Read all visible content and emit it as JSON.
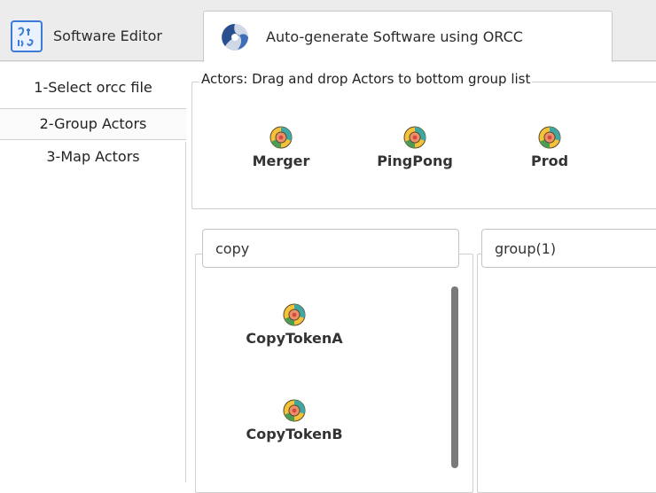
{
  "tabs": [
    {
      "label": "Software Editor",
      "icon": "software-editor-icon",
      "active": false
    },
    {
      "label": "Auto-generate Software using ORCC",
      "icon": "orcc-icon",
      "active": true
    }
  ],
  "steps": [
    {
      "label": "1-Select orcc file",
      "selected": false
    },
    {
      "label": "2-Group Actors",
      "selected": true
    },
    {
      "label": "3-Map Actors",
      "selected": false
    }
  ],
  "actors_panel": {
    "title": "Actors: Drag and drop Actors to bottom group list",
    "actors": [
      {
        "label": "Merger",
        "icon": "actor-icon"
      },
      {
        "label": "PingPong",
        "icon": "actor-icon"
      },
      {
        "label": "Prod",
        "icon": "actor-icon"
      }
    ]
  },
  "groups": [
    {
      "name": "copy",
      "actors": [
        {
          "label": "CopyTokenA",
          "icon": "actor-icon"
        },
        {
          "label": "CopyTokenB",
          "icon": "actor-icon"
        }
      ]
    },
    {
      "name": "group(1)",
      "actors": []
    }
  ],
  "colors": {
    "accent_blue": "#3d7bd9",
    "actor_yellow": "#f3c13a",
    "actor_teal": "#3fa6a1",
    "actor_red": "#d6493b"
  }
}
